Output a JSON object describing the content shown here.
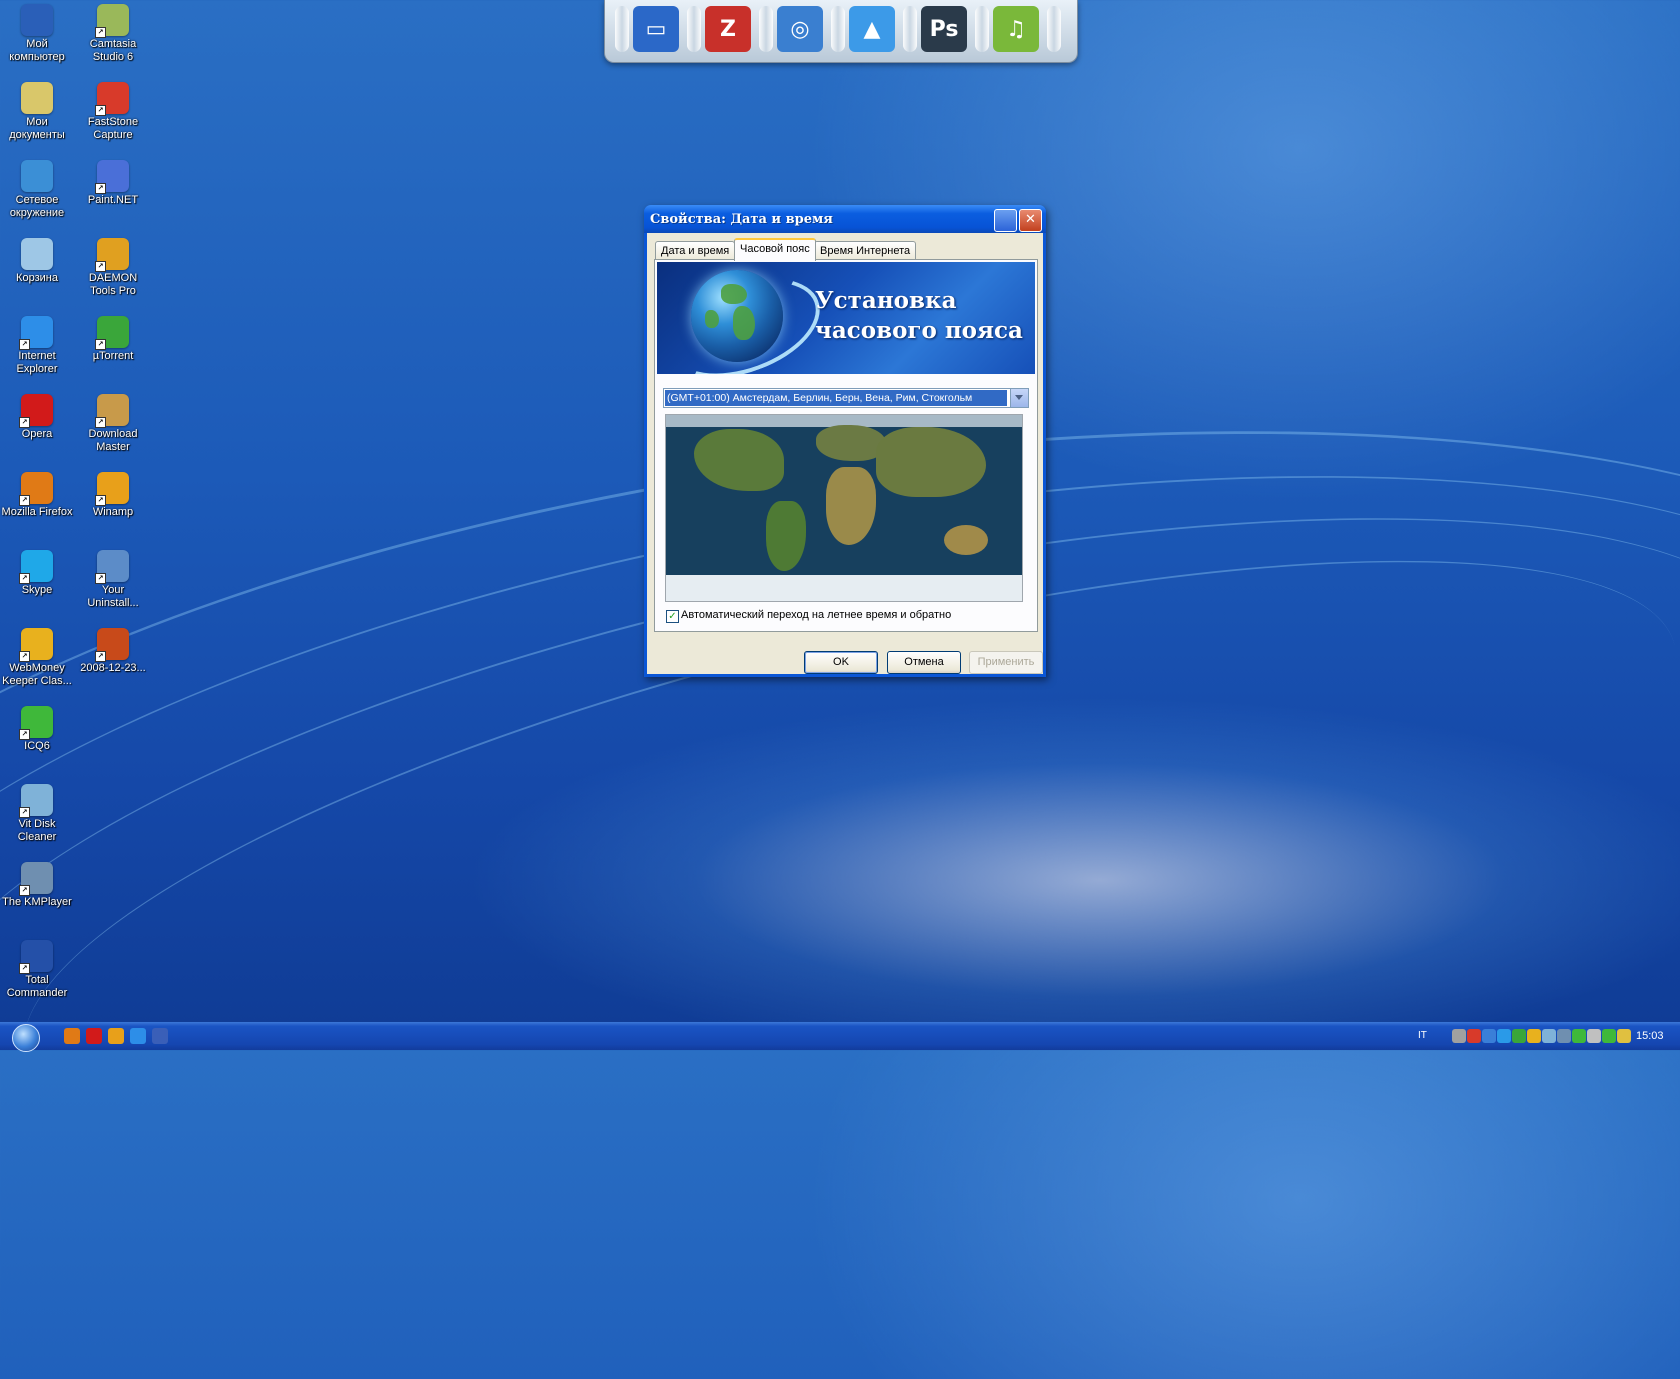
{
  "desktop": {
    "icons": [
      {
        "label": "Мой компьютер",
        "icon": "my-computer-icon",
        "color": "#2a5fb8"
      },
      {
        "label": "Мои документы",
        "icon": "my-documents-icon",
        "color": "#d9c76a"
      },
      {
        "label": "Сетевое окружение",
        "icon": "network-places-icon",
        "color": "#3b8fd6"
      },
      {
        "label": "Корзина",
        "icon": "recycle-bin-icon",
        "color": "#9ec7e6"
      },
      {
        "label": "Internet Explorer",
        "icon": "internet-explorer-icon",
        "color": "#2d8ee8"
      },
      {
        "label": "Opera",
        "icon": "opera-icon",
        "color": "#d21a1a"
      },
      {
        "label": "Mozilla Firefox",
        "icon": "firefox-icon",
        "color": "#e07a16"
      },
      {
        "label": "Skype",
        "icon": "skype-icon",
        "color": "#1fa8e8"
      },
      {
        "label": "WebMoney Keeper Clas...",
        "icon": "webmoney-icon",
        "color": "#e8b11e"
      },
      {
        "label": "ICQ6",
        "icon": "icq-icon",
        "color": "#3fb83a"
      },
      {
        "label": "Vit Disk Cleaner",
        "icon": "disk-cleaner-icon",
        "color": "#7fb2d8"
      },
      {
        "label": "The KMPlayer",
        "icon": "kmplayer-icon",
        "color": "#6f8fb0"
      },
      {
        "label": "Total Commander",
        "icon": "total-commander-icon",
        "color": "#2450a8"
      },
      {
        "label": "Camtasia Studio 6",
        "icon": "camtasia-icon",
        "color": "#9ab85a"
      },
      {
        "label": "FastStone Capture",
        "icon": "faststone-icon",
        "color": "#d83a2a"
      },
      {
        "label": "Paint.NET",
        "icon": "paint-net-icon",
        "color": "#4a6fd8"
      },
      {
        "label": "DAEMON Tools Pro",
        "icon": "daemon-tools-icon",
        "color": "#e0a020"
      },
      {
        "label": "µTorrent",
        "icon": "utorrent-icon",
        "color": "#3aa63a"
      },
      {
        "label": "Download Master",
        "icon": "download-master-icon",
        "color": "#c89a4a"
      },
      {
        "label": "Winamp",
        "icon": "winamp-icon",
        "color": "#e8a01a"
      },
      {
        "label": "Your Uninstall...",
        "icon": "your-uninstaller-icon",
        "color": "#5c8cc8"
      },
      {
        "label": "2008-12-23...",
        "icon": "image-file-icon",
        "color": "#c84a1a"
      }
    ]
  },
  "dock": {
    "items": [
      {
        "name": "computer",
        "icon": "monitor-icon",
        "glyph": "▭",
        "color": "#2b68c8"
      },
      {
        "name": "filezilla",
        "icon": "filezilla-icon",
        "glyph": "Z",
        "color": "#c8302a"
      },
      {
        "name": "browser",
        "icon": "globe-icon",
        "glyph": "◎",
        "color": "#3a7fd0"
      },
      {
        "name": "upload",
        "icon": "up-arrow-icon",
        "glyph": "▲",
        "color": "#3c9ae8"
      },
      {
        "name": "photoshop",
        "icon": "photoshop-icon",
        "glyph": "Ps",
        "color": "#2a3a4a"
      },
      {
        "name": "music",
        "icon": "music-note-icon",
        "glyph": "♫",
        "color": "#7ab83a"
      }
    ]
  },
  "dialog": {
    "title": "Свойства: Дата и время",
    "tabs": [
      {
        "label": "Дата и время",
        "active": false
      },
      {
        "label": "Часовой пояс",
        "active": true
      },
      {
        "label": "Время Интернета",
        "active": false
      }
    ],
    "banner_title_line1": "Установка",
    "banner_title_line2": "часового пояса",
    "timezone_selected": "(GMT+01:00) Амстердам, Берлин, Берн, Вена, Рим, Стокгольм",
    "dst_checkbox_checked": true,
    "dst_label": "Автоматический переход на летнее время и обратно",
    "buttons": {
      "ok": "OK",
      "cancel": "Отмена",
      "apply": "Применить"
    }
  },
  "taskbar": {
    "language": "IT",
    "clock": "15:03",
    "quicklaunch": [
      {
        "icon": "firefox-icon",
        "color": "#e07a16"
      },
      {
        "icon": "opera-icon",
        "color": "#d21a1a"
      },
      {
        "icon": "winamp-icon",
        "color": "#e8a01a"
      },
      {
        "icon": "internet-explorer-icon",
        "color": "#2d8ee8"
      },
      {
        "icon": "show-desktop-icon",
        "color": "#3a5fb8"
      }
    ],
    "tray": [
      {
        "icon": "network-tray-icon",
        "color": "#a0a0a0"
      },
      {
        "icon": "antivirus-tray-icon",
        "color": "#d83a2a"
      },
      {
        "icon": "bluetooth-tray-icon",
        "color": "#3a7fd8"
      },
      {
        "icon": "sync-tray-icon",
        "color": "#2a9ae8"
      },
      {
        "icon": "utorrent-tray-icon",
        "color": "#3aa63a"
      },
      {
        "icon": "webmoney-tray-icon",
        "color": "#e8b11e"
      },
      {
        "icon": "messenger-tray-icon",
        "color": "#7fb2d8"
      },
      {
        "icon": "printer-tray-icon",
        "color": "#6f8fb0"
      },
      {
        "icon": "network-connection-tray-icon",
        "color": "#3fb83a"
      },
      {
        "icon": "volume-tray-icon",
        "color": "#c0c0c0"
      },
      {
        "icon": "icq-tray-icon",
        "color": "#3fb83a"
      },
      {
        "icon": "safely-remove-tray-icon",
        "color": "#e0c040"
      }
    ]
  }
}
